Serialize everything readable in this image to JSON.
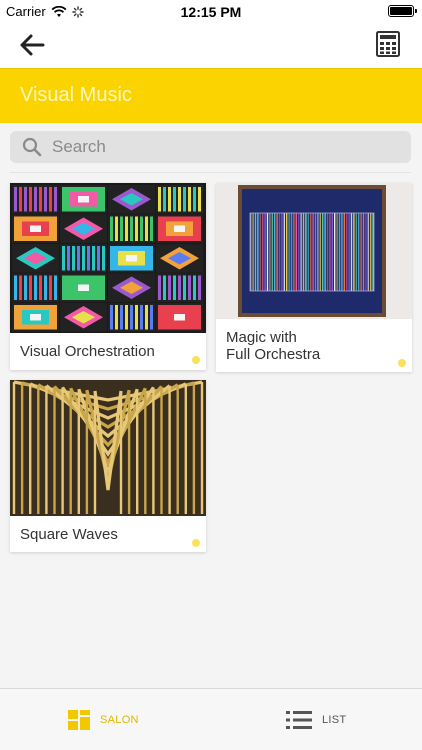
{
  "status_bar": {
    "carrier": "Carrier",
    "time": "12:15 PM"
  },
  "nav": {
    "back_icon": "arrow-left-icon",
    "calculator_icon": "calculator-icon"
  },
  "title": "Visual Music",
  "search": {
    "placeholder": "Search",
    "value": ""
  },
  "artworks": [
    {
      "title": "Visual Orchestration"
    },
    {
      "title": "Magic with\nFull Orchestra"
    },
    {
      "title": "Square Waves"
    }
  ],
  "tabs": [
    {
      "label": "SALON",
      "icon": "grid-icon",
      "selected": true
    },
    {
      "label": "LIST",
      "icon": "list-icon",
      "selected": false
    }
  ],
  "colors": {
    "accent": "#fbd400",
    "dot": "#fbe05a",
    "tab_active": "#e0b800"
  }
}
